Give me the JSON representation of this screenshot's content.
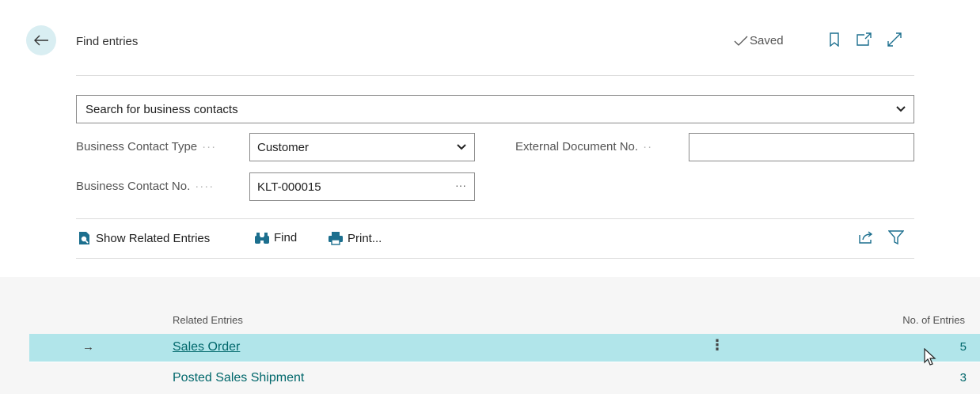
{
  "header": {
    "title": "Find entries",
    "saved_label": "Saved",
    "back_icon": "arrow-left-icon",
    "icons": [
      "bookmark-icon",
      "open-new-window-icon",
      "expand-icon"
    ]
  },
  "search": {
    "value": "Search for business contacts"
  },
  "fields": {
    "contact_type_label": "Business Contact Type",
    "contact_type_value": "Customer",
    "external_doc_label": "External Document No.",
    "external_doc_value": "",
    "contact_no_label": "Business Contact No.",
    "contact_no_value": "KLT-000015",
    "lookup_ellipsis": "···"
  },
  "actions": {
    "show_related": "Show Related Entries",
    "find": "Find",
    "print": "Print..."
  },
  "list": {
    "col_related": "Related Entries",
    "col_count": "No. of Entries",
    "rows": [
      {
        "name": "Sales Order",
        "count": "5",
        "selected": true
      },
      {
        "name": "Posted Sales Shipment",
        "count": "3",
        "selected": false
      }
    ]
  },
  "colors": {
    "accent": "#00676b",
    "selected_row": "#b1e5ea",
    "back_button_bg": "#d9eef2"
  }
}
